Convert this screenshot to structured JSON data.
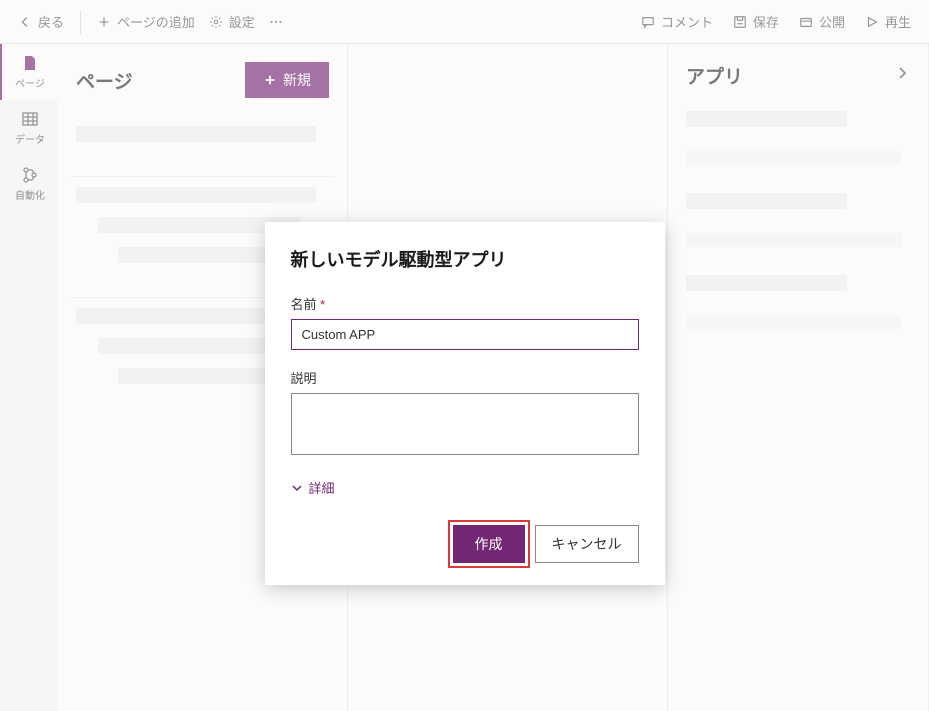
{
  "toolbar": {
    "back": "戻る",
    "add_page": "ページの追加",
    "settings": "設定",
    "comment": "コメント",
    "save": "保存",
    "publish": "公開",
    "play": "再生"
  },
  "nav": {
    "pages": "ページ",
    "data": "データ",
    "automation": "自動化"
  },
  "pages_panel": {
    "title": "ページ",
    "new_btn": "新規"
  },
  "app_panel": {
    "title": "アプリ"
  },
  "modal": {
    "title": "新しいモデル駆動型アプリ",
    "name_label": "名前",
    "name_value": "Custom APP",
    "desc_label": "説明",
    "desc_value": "",
    "details": "詳細",
    "create": "作成",
    "cancel": "キャンセル"
  }
}
